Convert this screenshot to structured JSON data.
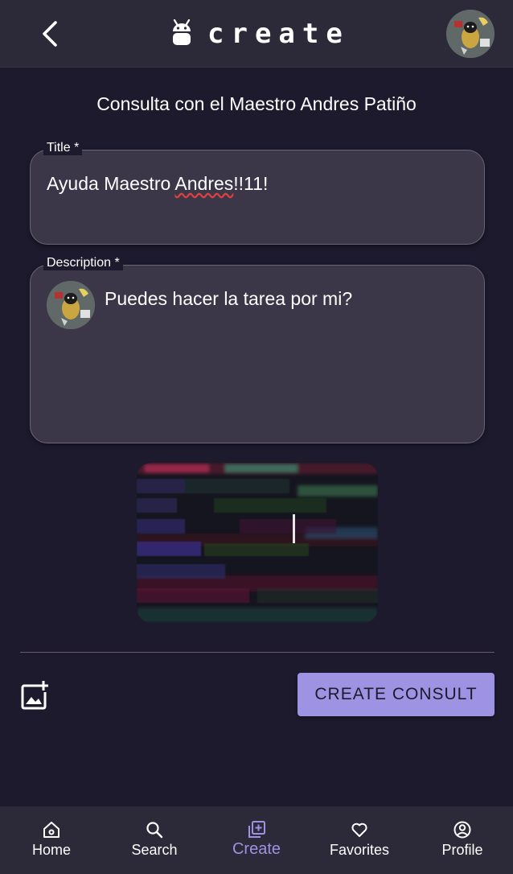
{
  "header": {
    "title": "create",
    "icons": {
      "back": "chevron-left-icon",
      "brand": "android-icon",
      "avatar": "user-avatar"
    }
  },
  "heading": "Consulta con el Maestro Andres Patiño",
  "form": {
    "title_label": "Title *",
    "title_value_part1": "Ayuda Maestro ",
    "title_value_misspelled": "Andres",
    "title_value_part2": "!!11!",
    "description_label": "Description *",
    "description_value": "Puedes hacer la tarea por mi?"
  },
  "actions": {
    "add_image_icon": "add-photo-icon",
    "create_label": "CREATE CONSULT"
  },
  "nav": {
    "items": [
      {
        "label": "Home",
        "icon": "home-icon"
      },
      {
        "label": "Search",
        "icon": "search-icon"
      },
      {
        "label": "Create",
        "icon": "add-box-icon"
      },
      {
        "label": "Favorites",
        "icon": "heart-icon"
      },
      {
        "label": "Profile",
        "icon": "account-circle-icon"
      }
    ],
    "active": "Create"
  },
  "colors": {
    "background": "#1d1a2e",
    "bar": "#2c2939",
    "field": "#3b3748",
    "accent": "#9e93e2"
  }
}
